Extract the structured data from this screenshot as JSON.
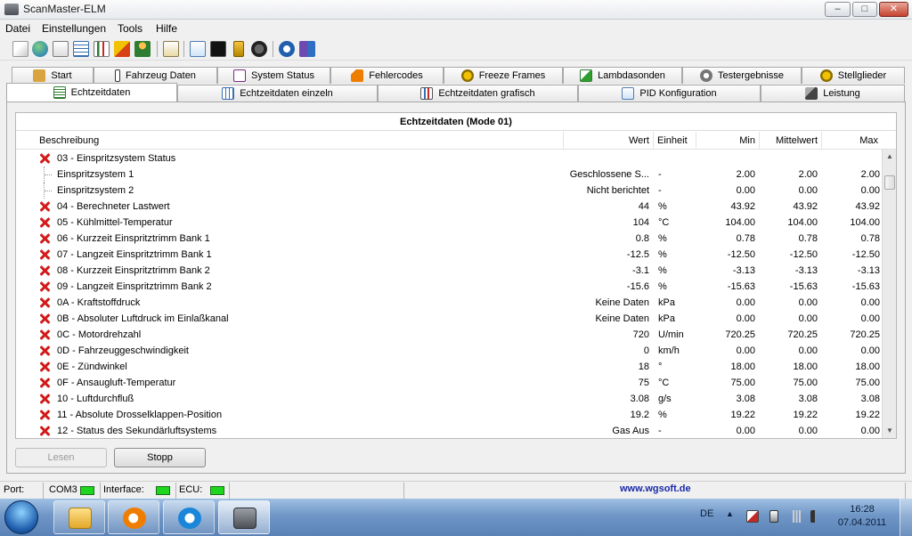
{
  "window": {
    "title": "ScanMaster-ELM"
  },
  "menu": [
    "Datei",
    "Einstellungen",
    "Tools",
    "Hilfe"
  ],
  "tabs_row1": [
    "Start",
    "Fahrzeug Daten",
    "System Status",
    "Fehlercodes",
    "Freeze Frames",
    "Lambdasonden",
    "Testergebnisse",
    "Stellglieder"
  ],
  "tabs_row2": [
    "Echtzeitdaten",
    "Echtzeitdaten einzeln",
    "Echtzeitdaten grafisch",
    "PID Konfiguration",
    "Leistung"
  ],
  "grid": {
    "title": "Echtzeitdaten (Mode 01)",
    "columns": [
      "Beschreibung",
      "Wert",
      "Einheit",
      "Min",
      "Mittelwert",
      "Max"
    ],
    "rows": [
      {
        "desc": "03 - Einspritzsystem Status",
        "wert": "",
        "einheit": "",
        "min": "",
        "mittel": "",
        "max": "",
        "type": "error"
      },
      {
        "desc": "Einspritzsystem 1",
        "wert": "Geschlossene S...",
        "einheit": "-",
        "min": "2.00",
        "mittel": "2.00",
        "max": "2.00",
        "type": "child"
      },
      {
        "desc": "Einspritzsystem 2",
        "wert": "Nicht berichtet",
        "einheit": "-",
        "min": "0.00",
        "mittel": "0.00",
        "max": "0.00",
        "type": "child"
      },
      {
        "desc": "04 - Berechneter Lastwert",
        "wert": "44",
        "einheit": "%",
        "min": "43.92",
        "mittel": "43.92",
        "max": "43.92",
        "type": "error"
      },
      {
        "desc": "05 - Kühlmittel-Temperatur",
        "wert": "104",
        "einheit": "°C",
        "min": "104.00",
        "mittel": "104.00",
        "max": "104.00",
        "type": "error"
      },
      {
        "desc": "06 - Kurzzeit Einspritztrimm Bank 1",
        "wert": "0.8",
        "einheit": "%",
        "min": "0.78",
        "mittel": "0.78",
        "max": "0.78",
        "type": "error"
      },
      {
        "desc": "07 - Langzeit Einspritztrimm Bank 1",
        "wert": "-12.5",
        "einheit": "%",
        "min": "-12.50",
        "mittel": "-12.50",
        "max": "-12.50",
        "type": "error"
      },
      {
        "desc": "08 - Kurzzeit Einspritztrimm Bank 2",
        "wert": "-3.1",
        "einheit": "%",
        "min": "-3.13",
        "mittel": "-3.13",
        "max": "-3.13",
        "type": "error"
      },
      {
        "desc": "09 - Langzeit Einspritztrimm Bank 2",
        "wert": "-15.6",
        "einheit": "%",
        "min": "-15.63",
        "mittel": "-15.63",
        "max": "-15.63",
        "type": "error"
      },
      {
        "desc": "0A - Kraftstoffdruck",
        "wert": "Keine Daten",
        "einheit": "kPa",
        "min": "0.00",
        "mittel": "0.00",
        "max": "0.00",
        "type": "error"
      },
      {
        "desc": "0B - Absoluter Luftdruck im Einlaßkanal",
        "wert": "Keine Daten",
        "einheit": "kPa",
        "min": "0.00",
        "mittel": "0.00",
        "max": "0.00",
        "type": "error"
      },
      {
        "desc": "0C - Motordrehzahl",
        "wert": "720",
        "einheit": "U/min",
        "min": "720.25",
        "mittel": "720.25",
        "max": "720.25",
        "type": "error"
      },
      {
        "desc": "0D - Fahrzeuggeschwindigkeit",
        "wert": "0",
        "einheit": "km/h",
        "min": "0.00",
        "mittel": "0.00",
        "max": "0.00",
        "type": "error"
      },
      {
        "desc": "0E - Zündwinkel",
        "wert": "18",
        "einheit": "°",
        "min": "18.00",
        "mittel": "18.00",
        "max": "18.00",
        "type": "error"
      },
      {
        "desc": "0F - Ansaugluft-Temperatur",
        "wert": "75",
        "einheit": "°C",
        "min": "75.00",
        "mittel": "75.00",
        "max": "75.00",
        "type": "error"
      },
      {
        "desc": "10 - Luftdurchfluß",
        "wert": "3.08",
        "einheit": "g/s",
        "min": "3.08",
        "mittel": "3.08",
        "max": "3.08",
        "type": "error"
      },
      {
        "desc": "11 - Absolute Drosselklappen-Position",
        "wert": "19.2",
        "einheit": "%",
        "min": "19.22",
        "mittel": "19.22",
        "max": "19.22",
        "type": "error"
      },
      {
        "desc": "12 - Status des Sekundärluftsystems",
        "wert": "Gas Aus",
        "einheit": "-",
        "min": "0.00",
        "mittel": "0.00",
        "max": "0.00",
        "type": "error"
      }
    ]
  },
  "buttons": {
    "lesen": "Lesen",
    "stopp": "Stopp"
  },
  "status": {
    "port_label": "Port:",
    "port_value": "COM3",
    "interface_label": "Interface:",
    "ecu_label": "ECU:",
    "website": "www.wgsoft.de"
  },
  "tray": {
    "lang": "DE",
    "time": "16:28",
    "date": "07.04.2011"
  }
}
